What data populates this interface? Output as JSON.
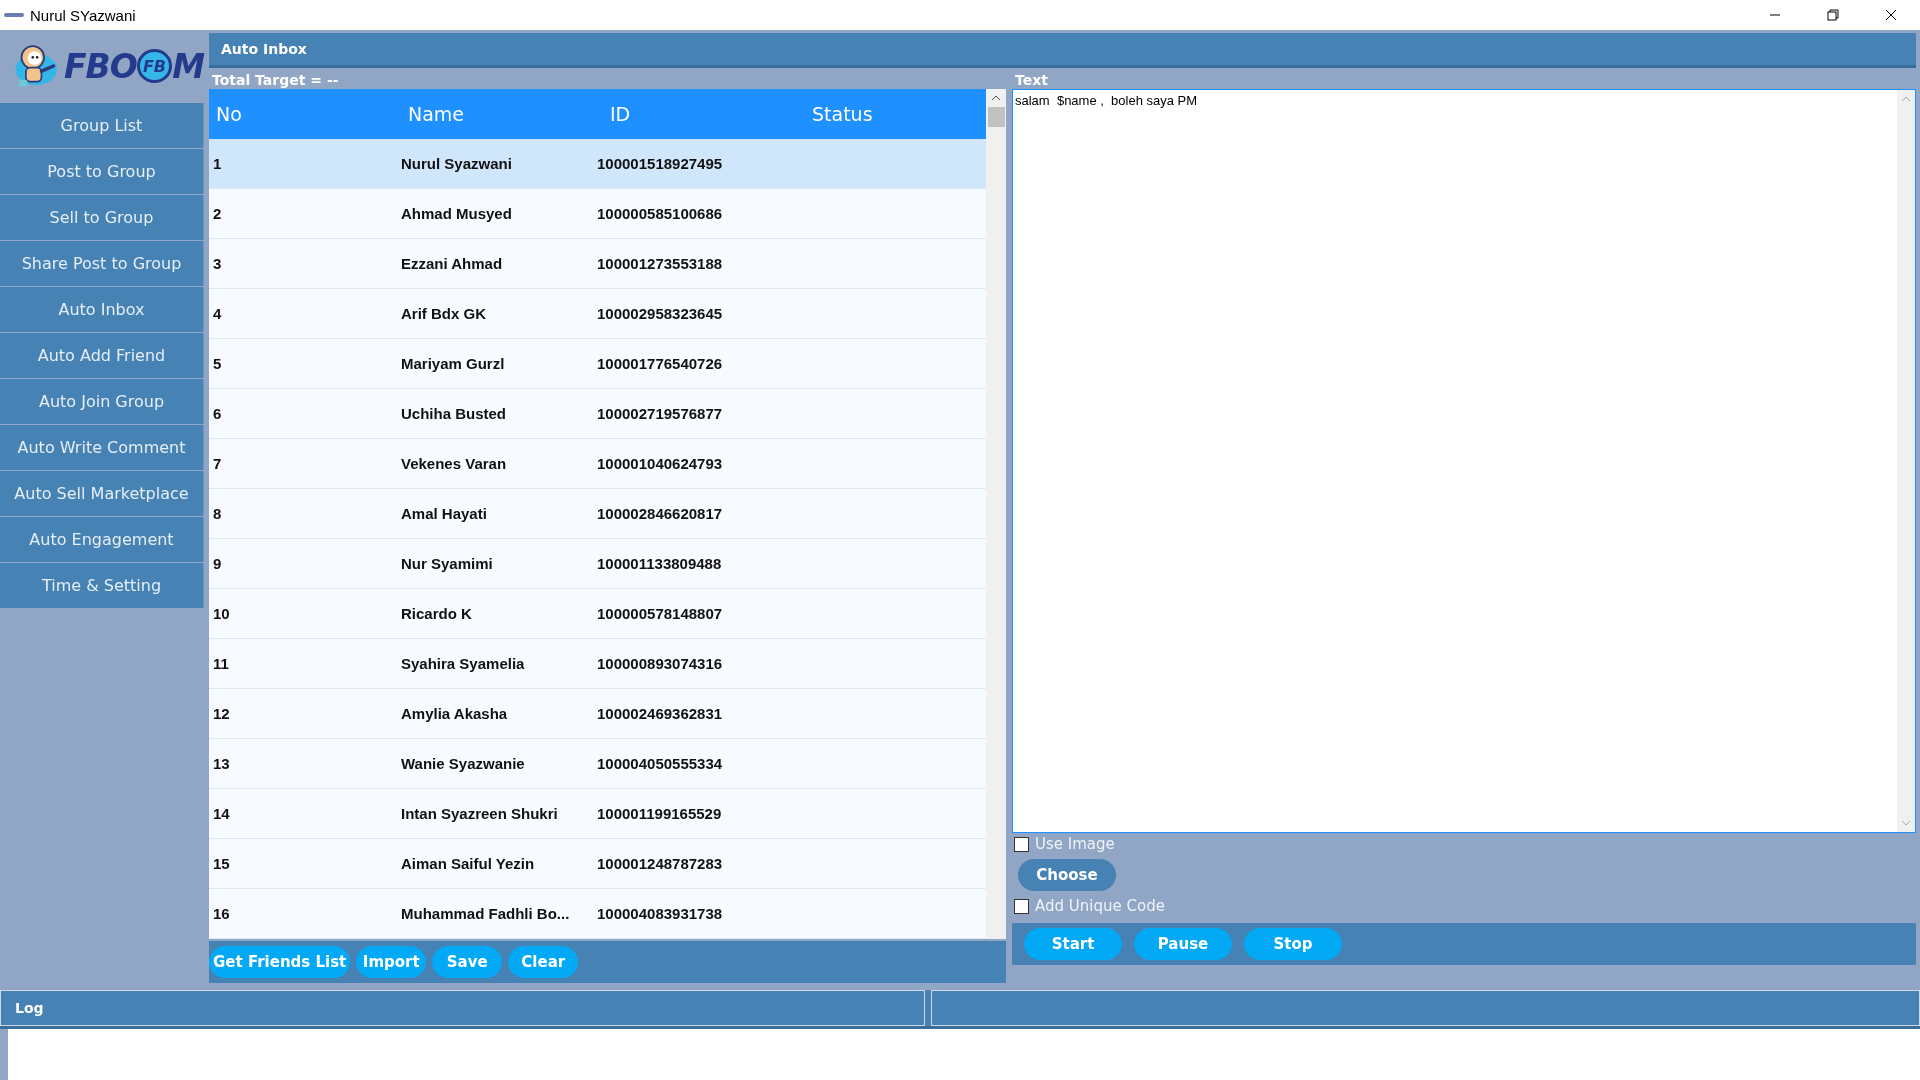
{
  "window": {
    "title": "Nurul SYazwani"
  },
  "logo": {
    "text_left": "FBO",
    "badge": "FB",
    "text_right": "M"
  },
  "sidebar": {
    "items": [
      {
        "label": "Group List"
      },
      {
        "label": "Post to Group"
      },
      {
        "label": "Sell to Group"
      },
      {
        "label": "Share Post to Group"
      },
      {
        "label": "Auto Inbox"
      },
      {
        "label": "Auto Add Friend"
      },
      {
        "label": "Auto Join Group"
      },
      {
        "label": "Auto Write Comment"
      },
      {
        "label": "Auto Sell Marketplace"
      },
      {
        "label": "Auto Engagement"
      },
      {
        "label": "Time & Setting"
      }
    ]
  },
  "page_title": "Auto Inbox",
  "total_target": "Total Target = --",
  "table": {
    "columns": [
      "No",
      "Name",
      "ID",
      "Status"
    ],
    "rows": [
      {
        "no": "1",
        "name": "Nurul Syazwani",
        "id": "100001518927495",
        "selected": true
      },
      {
        "no": "2",
        "name": "Ahmad Musyed",
        "id": "100000585100686",
        "selected": false
      },
      {
        "no": "3",
        "name": "Ezzani Ahmad",
        "id": "100001273553188",
        "selected": false
      },
      {
        "no": "4",
        "name": "Arif Bdx GK",
        "id": "100002958323645",
        "selected": false
      },
      {
        "no": "5",
        "name": "Mariyam Gurzl",
        "id": "100001776540726",
        "selected": false
      },
      {
        "no": "6",
        "name": "Uchiha Busted",
        "id": "100002719576877",
        "selected": false
      },
      {
        "no": "7",
        "name": "Vekenes Varan",
        "id": "100001040624793",
        "selected": false
      },
      {
        "no": "8",
        "name": "Amal Hayati",
        "id": "100002846620817",
        "selected": false
      },
      {
        "no": "9",
        "name": "Nur Syamimi",
        "id": "100001133809488",
        "selected": false
      },
      {
        "no": "10",
        "name": "Ricardo K",
        "id": "100000578148807",
        "selected": false
      },
      {
        "no": "11",
        "name": "Syahira Syamelia",
        "id": "100000893074316",
        "selected": false
      },
      {
        "no": "12",
        "name": "Amylia Akasha",
        "id": "100002469362831",
        "selected": false
      },
      {
        "no": "13",
        "name": "Wanie Syazwanie",
        "id": "100004050555334",
        "selected": false
      },
      {
        "no": "14",
        "name": "Intan Syazreen Shukri",
        "id": "100001199165529",
        "selected": false
      },
      {
        "no": "15",
        "name": "Aiman Saiful Yezin",
        "id": "100001248787283",
        "selected": false
      },
      {
        "no": "16",
        "name": "Muhammad Fadhli Bo...",
        "id": "100004083931738",
        "selected": false
      }
    ]
  },
  "list_buttons": [
    "Get Friends List",
    "Import",
    "Save",
    "Clear"
  ],
  "text_panel": {
    "label": "Text",
    "value": "salam  $name ,  boleh saya PM"
  },
  "use_image": {
    "label": "Use Image",
    "checked": false
  },
  "choose_button": "Choose",
  "unique_code": {
    "label": "Add Unique Code",
    "checked": false
  },
  "action_buttons": [
    "Start",
    "Pause",
    "Stop"
  ],
  "log": {
    "label": "Log"
  }
}
